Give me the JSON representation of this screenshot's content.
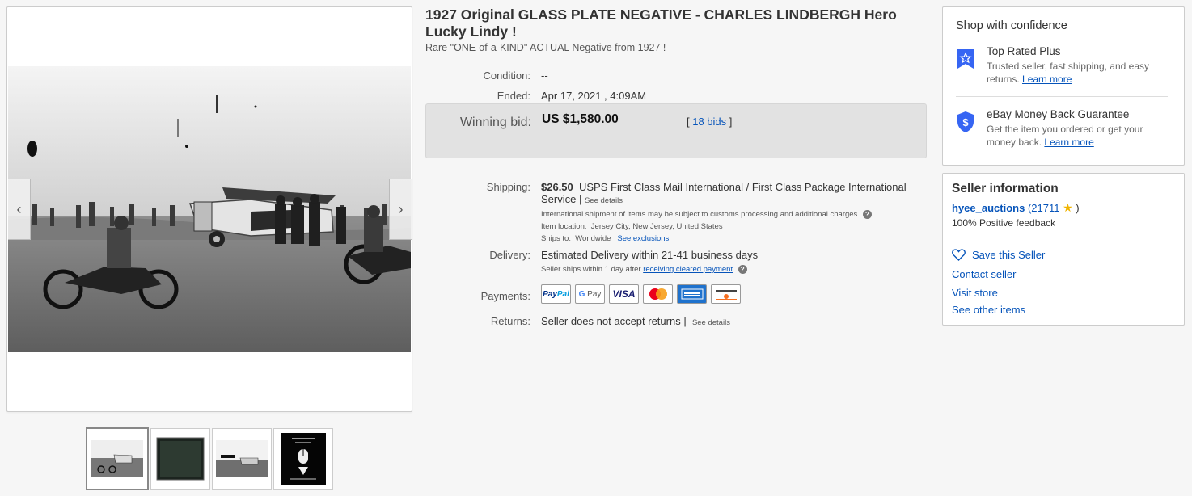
{
  "item": {
    "title": "1927 Original GLASS PLATE NEGATIVE - CHARLES LINDBERGH Hero Lucky Lindy !",
    "subtitle": "Rare \"ONE-of-a-KIND\" ACTUAL Negative from 1927 !"
  },
  "details": {
    "condition_label": "Condition:",
    "condition_value": "--",
    "ended_label": "Ended:",
    "ended_value": "Apr 17, 2021 , 4:09AM",
    "winning_bid_label": "Winning bid:",
    "winning_bid_value": "US $1,580.00",
    "bids_open": "[ ",
    "bids_link": "18 bids",
    "bids_close": " ]",
    "shipping_label": "Shipping:",
    "shipping_price": "$26.50",
    "shipping_service": "USPS First Class Mail International / First Class Package International Service |",
    "shipping_see_details": "See details",
    "shipping_note": "International shipment of items may be subject to customs processing and additional charges.",
    "item_location_label": "Item location:",
    "item_location_value": "Jersey City, New Jersey, United States",
    "ships_to_label": "Ships to:",
    "ships_to_value": "Worldwide",
    "see_exclusions": "See exclusions",
    "delivery_label": "Delivery:",
    "delivery_value": "Estimated Delivery within 21-41 business days",
    "handling_prefix": "Seller ships within 1 day after",
    "handling_link": "receiving cleared payment",
    "handling_suffix": ".",
    "payments_label": "Payments:",
    "returns_label": "Returns:",
    "returns_value": "Seller does not accept returns |",
    "returns_see_details": "See details"
  },
  "payments": [
    "PayPal",
    "G Pay",
    "VISA",
    "Mastercard",
    "American Express",
    "Discover"
  ],
  "confidence": {
    "title": "Shop with confidence",
    "top_rated_heading": "Top Rated Plus",
    "top_rated_desc": "Trusted seller, fast shipping, and easy returns.",
    "top_rated_link": "Learn more",
    "mbg_heading": "eBay Money Back Guarantee",
    "mbg_desc": "Get the item you ordered or get your money back.",
    "mbg_link": "Learn more"
  },
  "seller": {
    "title": "Seller information",
    "username": "hyee_auctions",
    "score_open": " (",
    "score": "21711",
    "score_close": " )",
    "feedback": "100% Positive feedback",
    "save": "Save this Seller",
    "contact": "Contact seller",
    "visit": "Visit store",
    "other": "See other items"
  },
  "colors": {
    "link": "#0654ba",
    "bid_box": "#e2e2e2",
    "badge_blue": "#3665f3"
  }
}
